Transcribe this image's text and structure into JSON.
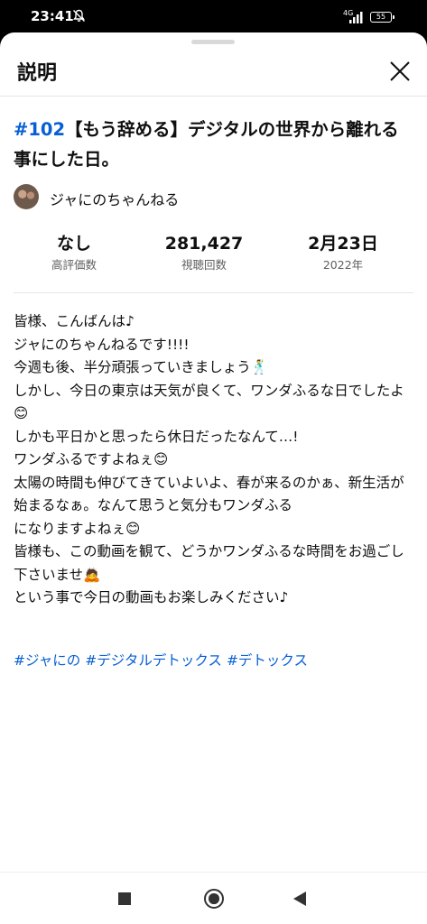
{
  "status_bar": {
    "time": "23:41",
    "network": "4G",
    "battery": "55"
  },
  "sheet": {
    "title": "説明"
  },
  "video": {
    "number_tag": "#102",
    "title": "【もう辞める】デジタルの世界から離れる事にした日。",
    "channel_name": "ジャにのちゃんねる"
  },
  "stats": {
    "likes_value": "なし",
    "likes_label": "高評価数",
    "views_value": "281,427",
    "views_label": "視聴回数",
    "date_value": "2月23日",
    "date_label": "2022年"
  },
  "description": {
    "text": "皆様、こんばんは♪\nジャにのちゃんねるです!!!!\n今週も後、半分頑張っていきましょう🕺\nしかし、今日の東京は天気が良くて、ワンダふるな日でしたよ😊\nしかも平日かと思ったら休日だったなんて…!\nワンダふるですよねぇ😊\n太陽の時間も伸びてきていよいよ、春が来るのかぁ、新生活が始まるなぁ。なんて思うと気分もワンダふる\nになりますよねぇ😊\n皆様も、この動画を観て、どうかワンダふるな時間をお過ごし下さいませ🙇\nという事で今日の動画もお楽しみください♪"
  },
  "hashtags": [
    "#ジャにの",
    "#デジタルデトックス",
    "#デトックス"
  ],
  "colors": {
    "link": "#065fd4",
    "text": "#0f0f0f",
    "secondary_text": "#606060"
  },
  "icons": {
    "close": "close-icon",
    "mute": "mute-icon",
    "signal": "signal-icon",
    "battery": "battery-icon"
  }
}
